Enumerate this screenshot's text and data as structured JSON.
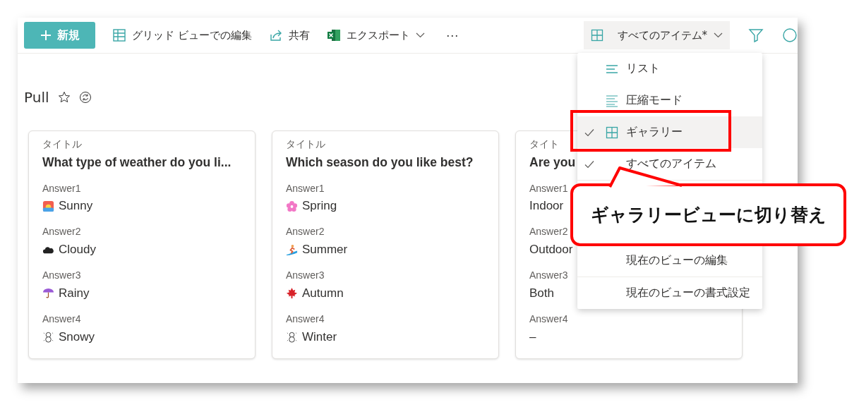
{
  "toolbar": {
    "new_button": {
      "label": "新規"
    },
    "items": [
      {
        "kind": "grid",
        "label": "グリッド ビューでの編集"
      },
      {
        "kind": "share",
        "label": "共有"
      },
      {
        "kind": "excel",
        "label": "エクスポート"
      }
    ],
    "more": "···",
    "view_selector": {
      "label": "すべてのアイテム*",
      "expanded": true
    }
  },
  "page_title": "Pull",
  "cards": [
    {
      "title_label": "タイトル",
      "title": "What type of weather do you li...",
      "fields": [
        {
          "label": "Answer1",
          "value": "Sunny"
        },
        {
          "label": "Answer2",
          "value": "Cloudy"
        },
        {
          "label": "Answer3",
          "value": "Rainy"
        },
        {
          "label": "Answer4",
          "value": "Snowy"
        }
      ]
    },
    {
      "title_label": "タイトル",
      "title": "Which season do you like best?",
      "fields": [
        {
          "label": "Answer1",
          "value": "Spring"
        },
        {
          "label": "Answer2",
          "value": "Summer"
        },
        {
          "label": "Answer3",
          "value": "Autumn"
        },
        {
          "label": "Answer4",
          "value": "Winter"
        }
      ]
    },
    {
      "title_label": "タイト",
      "title": "Are you",
      "fields": [
        {
          "label": "Answer1",
          "value": "Indoor"
        },
        {
          "label": "Answer2",
          "value": "Outdoor"
        },
        {
          "label": "Answer3",
          "value": "Both"
        },
        {
          "label": "Answer4",
          "value": "–"
        }
      ]
    }
  ],
  "view_menu": {
    "items": [
      {
        "kind": "view",
        "label": "リスト",
        "checked": false,
        "selected": false
      },
      {
        "kind": "view",
        "label": "圧縮モード",
        "checked": false,
        "selected": false
      },
      {
        "kind": "view",
        "label": "ギャラリー",
        "checked": true,
        "selected": true
      },
      {
        "kind": "view",
        "label": "すべてのアイテム",
        "checked": true,
        "selected": false
      },
      {
        "kind": "hidden"
      },
      {
        "kind": "action",
        "label": "現在のビューの編集",
        "checked": false,
        "selected": false
      },
      {
        "kind": "action",
        "label": "現在のビューの書式設定",
        "checked": false,
        "selected": false
      }
    ]
  },
  "annotation": {
    "callout": "ギャラリービューに切り替え"
  }
}
